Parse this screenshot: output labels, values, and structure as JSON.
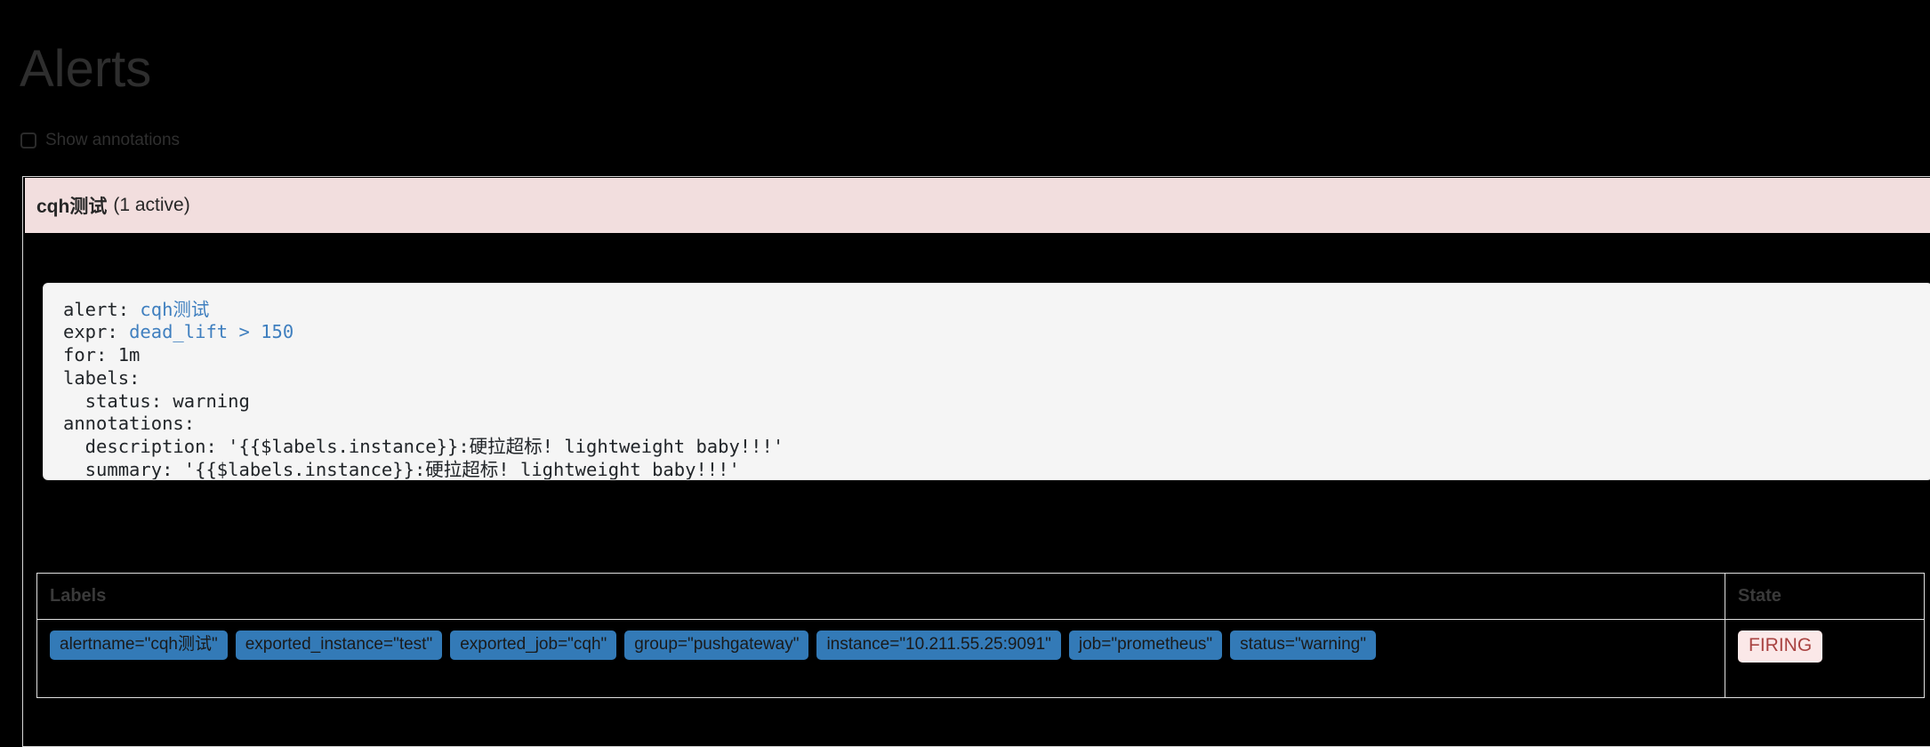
{
  "page": {
    "title": "Alerts"
  },
  "controls": {
    "show_annotations": {
      "label": "Show annotations",
      "checked": false,
      "icon": "checkbox-unchecked-icon"
    }
  },
  "alert_group": {
    "name": "cqh测试",
    "count_text": "(1 active)",
    "rule": {
      "lines": [
        {
          "key": "alert: ",
          "value": "cqh测试",
          "value_highlight": true
        },
        {
          "key": "expr: ",
          "value": "dead_lift > 150",
          "value_highlight": true
        },
        {
          "key": "for: 1m",
          "value": "",
          "value_highlight": false
        },
        {
          "key": "labels:",
          "value": "",
          "value_highlight": false
        },
        {
          "key": "  status: warning",
          "value": "",
          "value_highlight": false
        },
        {
          "key": "annotations:",
          "value": "",
          "value_highlight": false
        },
        {
          "key": "  description: '{{$labels.instance}}:硬拉超标! lightweight baby!!!'",
          "value": "",
          "value_highlight": false
        },
        {
          "key": "  summary: '{{$labels.instance}}:硬拉超标! lightweight baby!!!'",
          "value": "",
          "value_highlight": false
        }
      ],
      "alert_key": "alert: ",
      "alert_value": "cqh测试",
      "expr_key": "expr: ",
      "expr_value": "dead_lift > 150",
      "for_line": "for: 1m",
      "labels_line": "labels:",
      "labels_status_line": "  status: warning",
      "annotations_line": "annotations:",
      "annotations_description_line": "  description: '{{$labels.instance}}:硬拉超标! lightweight baby!!!'",
      "annotations_summary_line": "  summary: '{{$labels.instance}}:硬拉超标! lightweight baby!!!'"
    },
    "table": {
      "headers": {
        "labels": "Labels",
        "state": "State"
      },
      "rows": [
        {
          "labels": [
            "alertname=\"cqh测试\"",
            "exported_instance=\"test\"",
            "exported_job=\"cqh\"",
            "group=\"pushgateway\"",
            "instance=\"10.211.55.25:9091\"",
            "job=\"prometheus\"",
            "status=\"warning\""
          ],
          "state": "FIRING"
        }
      ]
    }
  },
  "colors": {
    "background": "#000000",
    "alert_header_bg": "#f2dede",
    "code_bg": "#f5f5f5",
    "code_value": "#3f7fbf",
    "label_badge_bg": "#337ab7",
    "state_badge_bg": "#fbe8e8",
    "state_badge_text": "#a94442",
    "table_border": "#e0e0e0"
  }
}
